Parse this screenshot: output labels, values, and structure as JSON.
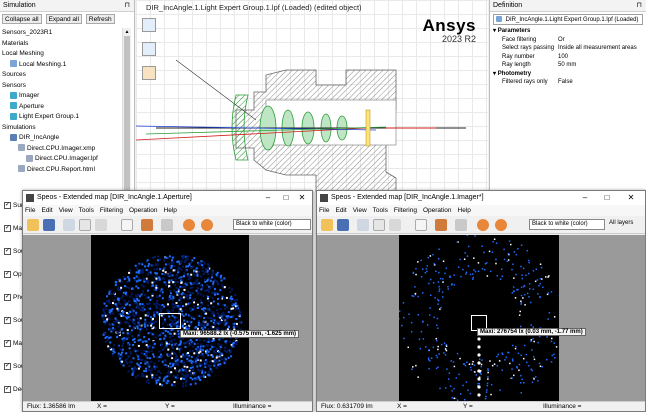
{
  "simulation_panel": {
    "title": "Simulation",
    "buttons": [
      "Collapse all",
      "Expand all",
      "Refresh"
    ],
    "tree": [
      {
        "label": "Sensors_2023R1",
        "indent": 0,
        "icon": "none"
      },
      {
        "label": "Materials",
        "indent": 0,
        "icon": "none"
      },
      {
        "label": "Local Meshing",
        "indent": 0,
        "icon": "none"
      },
      {
        "label": "Local Meshing.1",
        "indent": 1,
        "icon": "mesh"
      },
      {
        "label": "Sources",
        "indent": 0,
        "icon": "none"
      },
      {
        "label": "Sensors",
        "indent": 0,
        "icon": "none"
      },
      {
        "label": "Imager",
        "indent": 1,
        "icon": "sensor"
      },
      {
        "label": "Aperture",
        "indent": 1,
        "icon": "sensor"
      },
      {
        "label": "Light Expert Group.1",
        "indent": 1,
        "icon": "sensor"
      },
      {
        "label": "Simulations",
        "indent": 0,
        "icon": "none"
      },
      {
        "label": "DIR_IncAngle",
        "indent": 1,
        "icon": "sim"
      },
      {
        "label": "Direct.CPU.Imager.xmp",
        "indent": 2,
        "icon": "file"
      },
      {
        "label": "Direct.CPU.Imager.lpf",
        "indent": 3,
        "icon": "file"
      },
      {
        "label": "Direct.CPU.Report.html",
        "indent": 2,
        "icon": "file"
      }
    ],
    "partial_rows": [
      "Sun",
      "Mat",
      "Sou",
      "Opto Me",
      "Photo-d",
      "Source",
      "Mat",
      "Sou",
      "Dec"
    ]
  },
  "viewport": {
    "title": "DIR_IncAngle.1.Light Expert Group.1.lpf (Loaded) (edited object)",
    "brand": "Ansys",
    "version": "2023 R2"
  },
  "definition_panel": {
    "title": "Definition",
    "selected": "DIR_IncAngle.1.Light Expert Group.1.lpf (Loaded)",
    "sections": [
      {
        "name": "Parameters",
        "rows": [
          {
            "k": "Face filtering",
            "v": "Or"
          },
          {
            "k": "Select rays passing",
            "v": "Inside all measurement areas"
          },
          {
            "k": "Ray number",
            "v": "100"
          },
          {
            "k": "Ray length",
            "v": "50 mm"
          }
        ]
      },
      {
        "name": "Photometry",
        "rows": [
          {
            "k": "Filtered rays only",
            "v": "False"
          }
        ]
      }
    ]
  },
  "map_left": {
    "title": "Speos - Extended map [DIR_IncAngle.1.Aperture]",
    "menu": [
      "File",
      "Edit",
      "View",
      "Tools",
      "Filtering",
      "Operation",
      "Help"
    ],
    "colormap": "Black to white (color)",
    "tooltip": "Maxi: 96588.2 lx (-0.575 mm, -1.625 mm)",
    "status": {
      "flux": "Flux: 1.36586 lm",
      "x": "X =",
      "y": "Y =",
      "illum": "Illuminance ="
    }
  },
  "map_right": {
    "title": "Speos - Extended map [DIR_IncAngle.1.Imager*]",
    "menu": [
      "File",
      "Edit",
      "View",
      "Tools",
      "Filtering",
      "Operation",
      "Help"
    ],
    "colormap": "Black to white (color)",
    "layers": "All layers",
    "tooltip": "Maxi: 276754 lx (0.03 mm, -1.77 mm)",
    "status": {
      "flux": "Flux: 0.631709 lm",
      "x": "X =",
      "y": "Y =",
      "illum": "Illuminance ="
    }
  },
  "icons": {
    "close": "close-icon",
    "minimize": "minimize-icon",
    "maximize": "maximize-icon",
    "pin": "pin-icon",
    "open": "folder-open-icon",
    "save": "save-icon"
  },
  "colors": {
    "accent": "#0078d7",
    "sensor_icon": "#3fa9c9",
    "heatmap_hot": "#ffffff",
    "heatmap_mid": "#1e6cff",
    "heatmap_low": "#001a66"
  }
}
